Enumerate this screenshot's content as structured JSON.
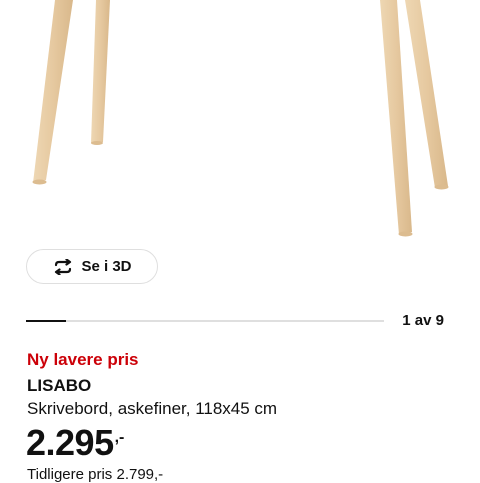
{
  "product": {
    "badge": "Ny lavere pris",
    "name": "LISABO",
    "description": "Skrivebord, askefiner, 118x45 cm",
    "price": "2.295",
    "price_suffix": ",-",
    "previous_price": "Tidligere pris 2.799,-"
  },
  "viewer": {
    "view_3d_label": "Se i 3D",
    "view_3d_icon": "rotate-3d-icon",
    "pager_text": "1 av 9",
    "pager_current": 1,
    "pager_total": 9
  },
  "colors": {
    "badge": "#cc0008",
    "text": "#111111",
    "wood": "#e6cda7"
  }
}
